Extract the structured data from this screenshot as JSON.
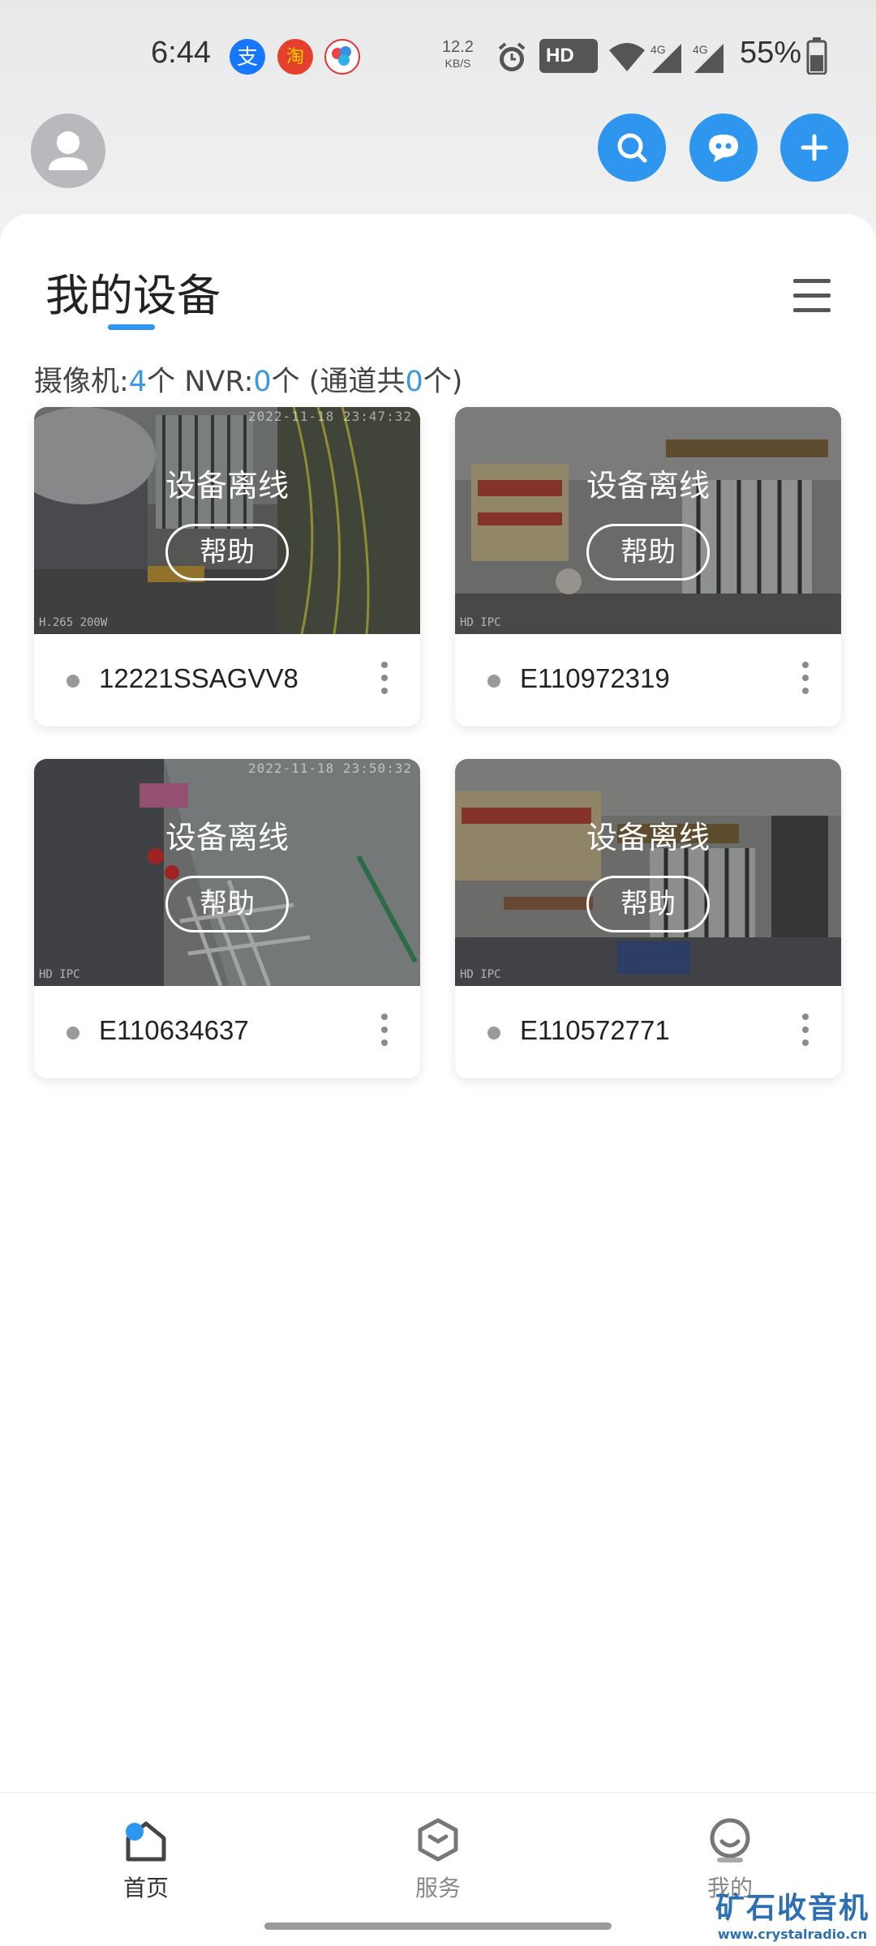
{
  "status_bar": {
    "time": "6:44",
    "alipay_glyph": "支",
    "taobao_glyph": "淘",
    "net_speed_value": "12.2",
    "net_speed_unit": "KB/S",
    "hd_label": "HD",
    "signal_label_1": "4G",
    "signal_label_2": "4G",
    "battery": "55%"
  },
  "header": {
    "title": "我的设备",
    "accent_color": "#2e96ee"
  },
  "summary": {
    "camera_label": "摄像机:",
    "camera_count": "4",
    "camera_unit": "个 NVR:",
    "nvr_count": "0",
    "nvr_unit": "个 (通道共",
    "channel_count": "0",
    "channel_unit": "个)"
  },
  "devices": [
    {
      "id": "12221SSAGVV8",
      "status": "设备离线",
      "help": "帮助",
      "stamp": "2022-11-18 23:47:32",
      "mark": "H.265 200W"
    },
    {
      "id": "E110972319",
      "status": "设备离线",
      "help": "帮助",
      "stamp": "",
      "mark": "HD IPC"
    },
    {
      "id": "E110634637",
      "status": "设备离线",
      "help": "帮助",
      "stamp": "2022-11-18 23:50:32",
      "mark": "HD IPC"
    },
    {
      "id": "E110572771",
      "status": "设备离线",
      "help": "帮助",
      "stamp": "",
      "mark": "HD IPC"
    }
  ],
  "nav": {
    "home": "首页",
    "service": "服务",
    "mine": "我的"
  },
  "watermark": {
    "main": "矿石收音机",
    "sub": "www.crystalradio.cn"
  }
}
